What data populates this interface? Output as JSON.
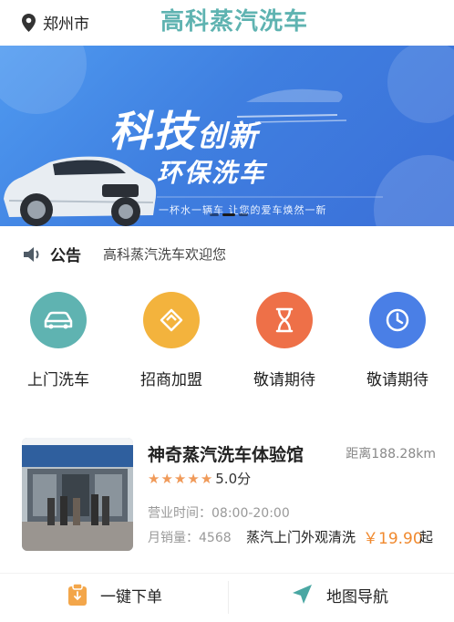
{
  "header": {
    "location": "郑州市",
    "brand": "高科蒸汽洗车"
  },
  "banner": {
    "slogan_main": "科技",
    "slogan_main_suffix": "创新",
    "slogan_sub": "环保洗车",
    "tagline": "一杯水一辆车   让您的爱车焕然一新"
  },
  "notice": {
    "label": "公告",
    "text": "高科蒸汽洗车欢迎您"
  },
  "services": [
    {
      "label": "上门洗车",
      "icon": "car-icon",
      "color": "#5fb3b1"
    },
    {
      "label": "招商加盟",
      "icon": "handshake-icon",
      "color": "#f3b33d"
    },
    {
      "label": "敬请期待",
      "icon": "hourglass-icon",
      "color": "#ee7048"
    },
    {
      "label": "敬请期待",
      "icon": "clock-icon",
      "color": "#4a7fe6"
    }
  ],
  "store": {
    "name": "神奇蒸汽洗车体验馆",
    "distance": "距离188.28km",
    "rating": "5.0分",
    "hours": "营业时间：08:00-20:00",
    "sales": "月销量：4568",
    "service": "蒸汽上门外观清洗",
    "price": "￥19.90",
    "price_suffix": "起",
    "rating_value": 5
  },
  "bottom": {
    "order_label": "一键下单",
    "nav_label": "地图导航"
  },
  "colors": {
    "accent": "#5fb3b1",
    "price": "#f0892e",
    "star": "#f09a59"
  }
}
